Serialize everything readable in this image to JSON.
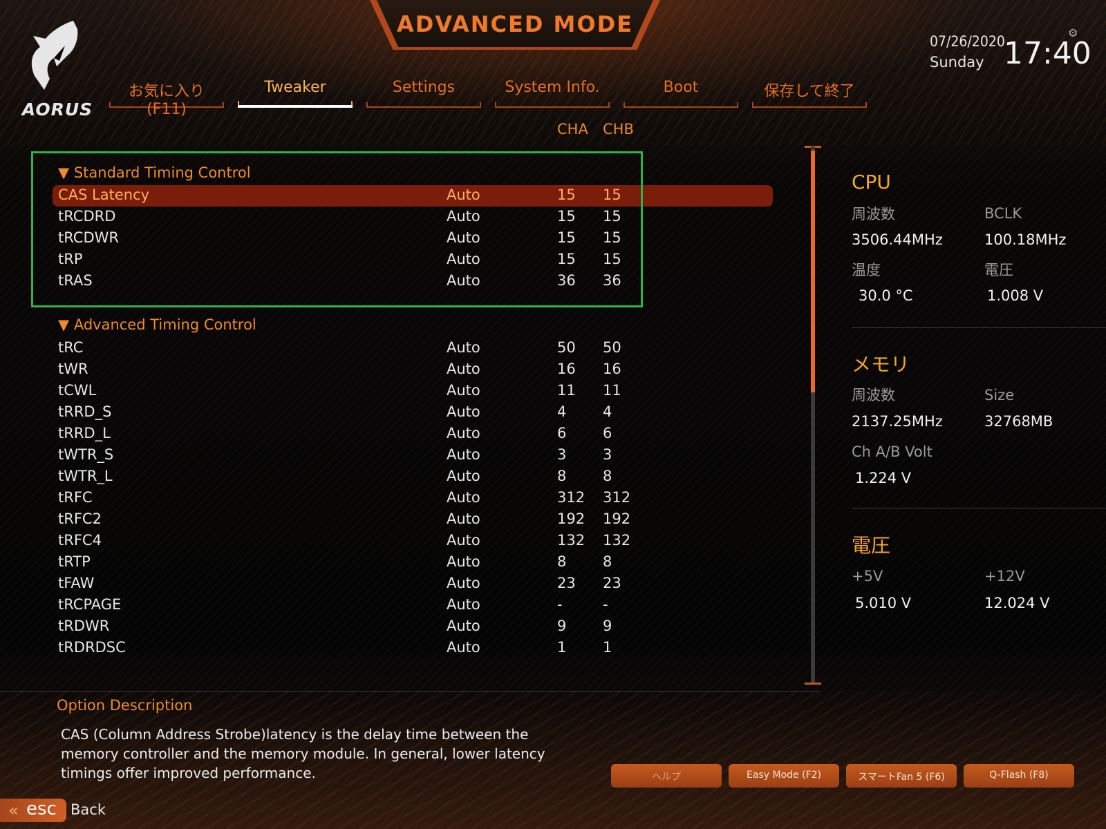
{
  "header": {
    "title": "ADVANCED MODE",
    "logo_text": "AORUS",
    "date": "07/26/2020",
    "day": "Sunday",
    "time": "17:40"
  },
  "tabs": [
    {
      "label": "お気に入り (F11)"
    },
    {
      "label": "Tweaker"
    },
    {
      "label": "Settings"
    },
    {
      "label": "System Info."
    },
    {
      "label": "Boot"
    },
    {
      "label": "保存して終了"
    }
  ],
  "active_tab": "Tweaker",
  "columns": {
    "cha": "CHA",
    "chb": "CHB"
  },
  "standard": {
    "title": "▼ Standard Timing Control",
    "rows": [
      {
        "name": "CAS Latency",
        "mode": "Auto",
        "cha": "15",
        "chb": "15"
      },
      {
        "name": "tRCDRD",
        "mode": "Auto",
        "cha": "15",
        "chb": "15"
      },
      {
        "name": "tRCDWR",
        "mode": "Auto",
        "cha": "15",
        "chb": "15"
      },
      {
        "name": "tRP",
        "mode": "Auto",
        "cha": "15",
        "chb": "15"
      },
      {
        "name": "tRAS",
        "mode": "Auto",
        "cha": "36",
        "chb": "36"
      }
    ]
  },
  "advanced": {
    "title": "▼ Advanced Timing Control",
    "rows": [
      {
        "name": "tRC",
        "mode": "Auto",
        "cha": "50",
        "chb": "50"
      },
      {
        "name": "tWR",
        "mode": "Auto",
        "cha": "16",
        "chb": "16"
      },
      {
        "name": "tCWL",
        "mode": "Auto",
        "cha": "11",
        "chb": "11"
      },
      {
        "name": "tRRD_S",
        "mode": "Auto",
        "cha": "4",
        "chb": "4"
      },
      {
        "name": "tRRD_L",
        "mode": "Auto",
        "cha": "6",
        "chb": "6"
      },
      {
        "name": "tWTR_S",
        "mode": "Auto",
        "cha": "3",
        "chb": "3"
      },
      {
        "name": "tWTR_L",
        "mode": "Auto",
        "cha": "8",
        "chb": "8"
      },
      {
        "name": "tRFC",
        "mode": "Auto",
        "cha": "312",
        "chb": "312"
      },
      {
        "name": "tRFC2",
        "mode": "Auto",
        "cha": "192",
        "chb": "192"
      },
      {
        "name": "tRFC4",
        "mode": "Auto",
        "cha": "132",
        "chb": "132"
      },
      {
        "name": "tRTP",
        "mode": "Auto",
        "cha": "8",
        "chb": "8"
      },
      {
        "name": "tFAW",
        "mode": "Auto",
        "cha": "23",
        "chb": "23"
      },
      {
        "name": "tRCPAGE",
        "mode": "Auto",
        "cha": "-",
        "chb": "-"
      },
      {
        "name": "tRDWR",
        "mode": "Auto",
        "cha": "9",
        "chb": "9"
      },
      {
        "name": "tRDRDSC",
        "mode": "Auto",
        "cha": "1",
        "chb": "1"
      }
    ]
  },
  "panel": {
    "cpu": {
      "title": "CPU",
      "freq_label": "周波数",
      "freq_value": "3506.44MHz",
      "bclk_label": "BCLK",
      "bclk_value": "100.18MHz",
      "temp_label": "温度",
      "temp_value": "30.0 °C",
      "volt_label": "電圧",
      "volt_value": "1.008 V"
    },
    "memory": {
      "title": "メモリ",
      "freq_label": "周波数",
      "freq_value": "2137.25MHz",
      "size_label": "Size",
      "size_value": "32768MB",
      "volt_label": "Ch A/B Volt",
      "volt_value": "1.224 V"
    },
    "voltage": {
      "title": "電圧",
      "v5_label": "+5V",
      "v5_value": "5.010 V",
      "v12_label": "+12V",
      "v12_value": "12.024 V"
    }
  },
  "description": {
    "title": "Option Description",
    "text": "CAS (Column Address Strobe)latency is the delay time between the memory controller and the memory module. In general, lower latency timings offer improved performance."
  },
  "footer_buttons": [
    {
      "label": "ヘルプ"
    },
    {
      "label": "Easy Mode (F2)"
    },
    {
      "label": "スマートFan 5 (F6)"
    },
    {
      "label": "Q-Flash (F8)"
    }
  ],
  "esc": {
    "key": "esc",
    "label": "Back"
  },
  "colors": {
    "accent": "#f08a2a",
    "selected_row": "#7a1d0b",
    "highlight_box": "#2fb34a",
    "panel_title": "#f5a623"
  }
}
